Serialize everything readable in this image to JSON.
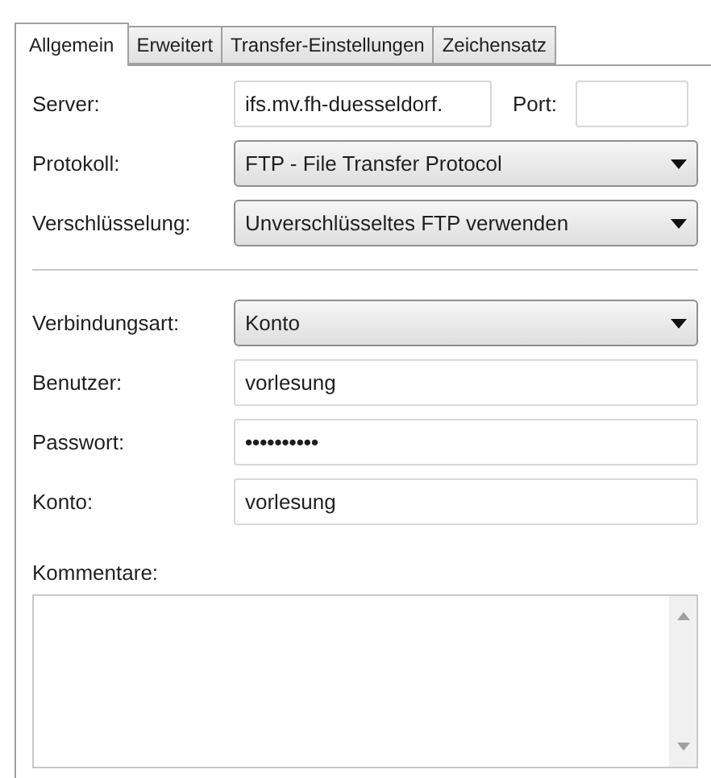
{
  "tabs": [
    {
      "label": "Allgemein",
      "selected": true
    },
    {
      "label": "Erweitert",
      "selected": false
    },
    {
      "label": "Transfer-Einstellungen",
      "selected": false
    },
    {
      "label": "Zeichensatz",
      "selected": false
    }
  ],
  "server": {
    "label": "Server:",
    "value": "ifs.mv.fh-duesseldorf.",
    "port_label": "Port:"
  },
  "upper_fields": [
    {
      "kind": "select",
      "label": "Protokoll:",
      "value": "FTP - File Transfer Protocol"
    },
    {
      "kind": "select",
      "label": "Verschlüsselung:",
      "value": "Unverschlüsseltes FTP verwenden"
    }
  ],
  "lower_fields": [
    {
      "kind": "select",
      "label": "Verbindungsart:",
      "value": "Konto"
    },
    {
      "kind": "text",
      "label": "Benutzer:",
      "value": "vorlesung"
    },
    {
      "kind": "password",
      "label": "Passwort:",
      "value": "••••••••••"
    },
    {
      "kind": "text",
      "label": "Konto:",
      "value": "vorlesung"
    }
  ],
  "comments": {
    "label": "Kommentare:"
  }
}
